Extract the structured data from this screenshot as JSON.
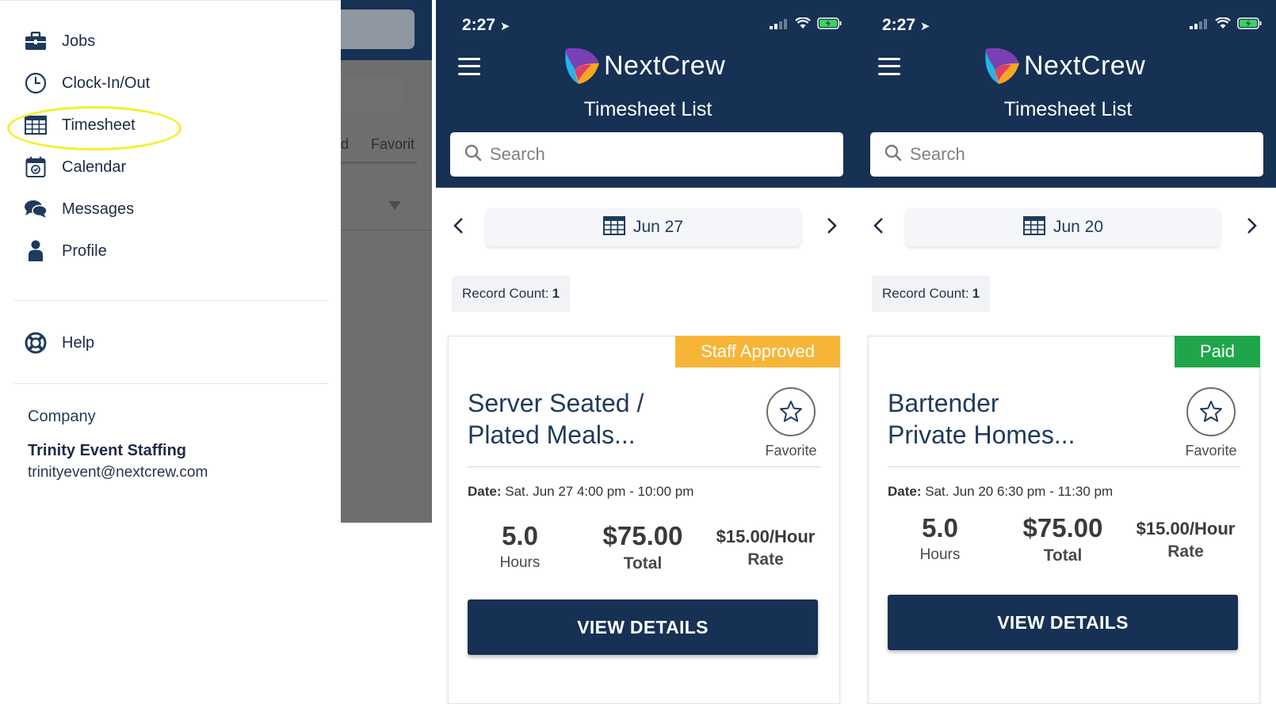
{
  "menu": {
    "items": [
      {
        "label": "Jobs",
        "icon": "briefcase-icon"
      },
      {
        "label": "Clock-In/Out",
        "icon": "clock-icon"
      },
      {
        "label": "Timesheet",
        "icon": "table-grid-icon"
      },
      {
        "label": "Calendar",
        "icon": "calendar-icon"
      },
      {
        "label": "Messages",
        "icon": "chat-bubbles-icon"
      },
      {
        "label": "Profile",
        "icon": "person-icon"
      }
    ],
    "help": {
      "label": "Help",
      "icon": "lifebuoy-icon"
    },
    "company": {
      "heading": "Company",
      "name": "Trinity Event Staffing",
      "email": "trinityevent@nextcrew.com"
    },
    "overlay_tabs": [
      "d",
      "Favorit"
    ],
    "highlight_color": "#f2f02a"
  },
  "screens": [
    {
      "status_time": "2:27",
      "app_name": "NextCrew",
      "title": "Timesheet List",
      "search_placeholder": "Search",
      "week_label": "Jun 27",
      "record_count_label": "Record Count:",
      "record_count": "1",
      "card": {
        "status": "Staff Approved",
        "status_color": "#f7b538",
        "title_line1": "Server Seated /",
        "title_line2": "Plated Meals...",
        "favorite_label": "Favorite",
        "date_label": "Date:",
        "date_value": "Sat. Jun 27 4:00 pm - 10:00 pm",
        "hours": "5.0",
        "hours_label": "Hours",
        "total": "$75.00",
        "total_label": "Total",
        "rate": "$15.00/Hour",
        "rate_label": "Rate",
        "button": "VIEW DETAILS"
      }
    },
    {
      "status_time": "2:27",
      "app_name": "NextCrew",
      "title": "Timesheet List",
      "search_placeholder": "Search",
      "week_label": "Jun 20",
      "record_count_label": "Record Count:",
      "record_count": "1",
      "card": {
        "status": "Paid",
        "status_color": "#1fa64a",
        "title_line1": "Bartender",
        "title_line2": "Private Homes...",
        "favorite_label": "Favorite",
        "date_label": "Date:",
        "date_value": "Sat. Jun 20 6:30 pm - 11:30 pm",
        "hours": "5.0",
        "hours_label": "Hours",
        "total": "$75.00",
        "total_label": "Total",
        "rate": "$15.00/Hour",
        "rate_label": "Rate",
        "button": "VIEW DETAILS"
      }
    }
  ],
  "colors": {
    "header_navy": "#163154",
    "text_navy": "#1f3a5c",
    "staff_approved": "#f7b538",
    "paid": "#1fa64a"
  }
}
